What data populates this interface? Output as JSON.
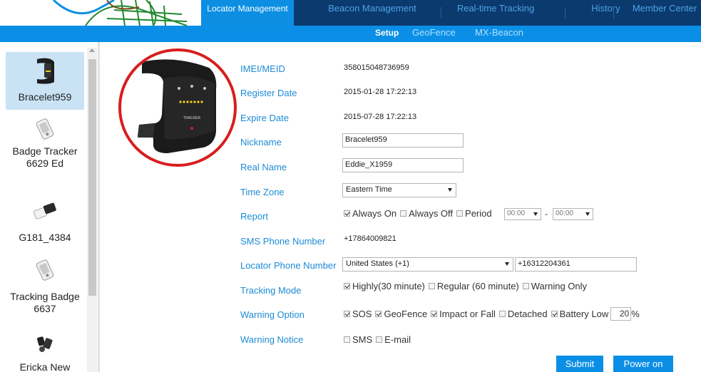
{
  "nav": {
    "tabs": [
      {
        "label": "Locator Management",
        "active": true
      },
      {
        "label": "Beacon Management",
        "active": false
      },
      {
        "label": "Real-time Tracking",
        "active": false
      },
      {
        "label": "History",
        "active": false
      },
      {
        "label": "Member Center",
        "active": false
      }
    ],
    "subtabs": [
      {
        "label": "Setup",
        "active": true
      },
      {
        "label": "GeoFence",
        "active": false
      },
      {
        "label": "MX-Beacon",
        "active": false
      }
    ]
  },
  "sidebar": {
    "devices": [
      {
        "name": "Bracelet959",
        "icon": "bracelet-icon",
        "selected": true
      },
      {
        "name": "Badge Tracker 6629 Ed",
        "icon": "badge-tracker-icon",
        "selected": false
      },
      {
        "name": "G181_4384",
        "icon": "g181-tracker-icon",
        "selected": false
      },
      {
        "name": "Tracking Badge 6637",
        "icon": "badge-tracker-icon",
        "selected": false
      },
      {
        "name": "Ericka New",
        "icon": "tracker-set-icon",
        "selected": false
      }
    ]
  },
  "form": {
    "imei_label": "IMEI/MEID",
    "imei_value": "358015048736959",
    "register_label": "Register Date",
    "register_value": "2015-01-28 17:22:13",
    "expire_label": "Expire Date",
    "expire_value": "2015-07-28 17:22:13",
    "nickname_label": "Nickname",
    "nickname_value": "Bracelet959",
    "realname_label": "Real Name",
    "realname_value": "Eddie_X1959",
    "timezone_label": "Time Zone",
    "timezone_value": "Eastern Time",
    "report_label": "Report",
    "report_always_on": "Always On",
    "report_always_off": "Always Off",
    "report_period": "Period",
    "report_period_from": "00:00",
    "report_period_dash": "-",
    "report_period_to": "00:00",
    "sms_label": "SMS Phone Number",
    "sms_value": "+17864009821",
    "locator_phone_label": "Locator Phone Number",
    "locator_country": "United States (+1)",
    "locator_phone_value": "+16312204361",
    "tracking_label": "Tracking Mode",
    "tracking_highly": "Highly(30 minute)",
    "tracking_regular": "Regular (60 minute)",
    "tracking_warning_only": "Warning Only",
    "warning_option_label": "Warning Option",
    "warn_sos": "SOS",
    "warn_geofence": "GeoFence",
    "warn_impact": "Impact or Fall",
    "warn_detached": "Detached",
    "warn_battery": "Battery Low",
    "warn_battery_pct": "20",
    "warn_battery_unit": "%",
    "warning_notice_label": "Warning Notice",
    "notice_sms": "SMS",
    "notice_email": "E-mail",
    "device_brand_text": "TRACKER"
  },
  "buttons": {
    "submit": "Submit",
    "power_on": "Power on"
  },
  "colors": {
    "nav_dark": "#0b3a6e",
    "accent_blue": "#0b8fe6",
    "label_blue": "#1c8bd6",
    "highlight_circle": "#d81e1e",
    "selected_bg": "#c9e3f5"
  }
}
